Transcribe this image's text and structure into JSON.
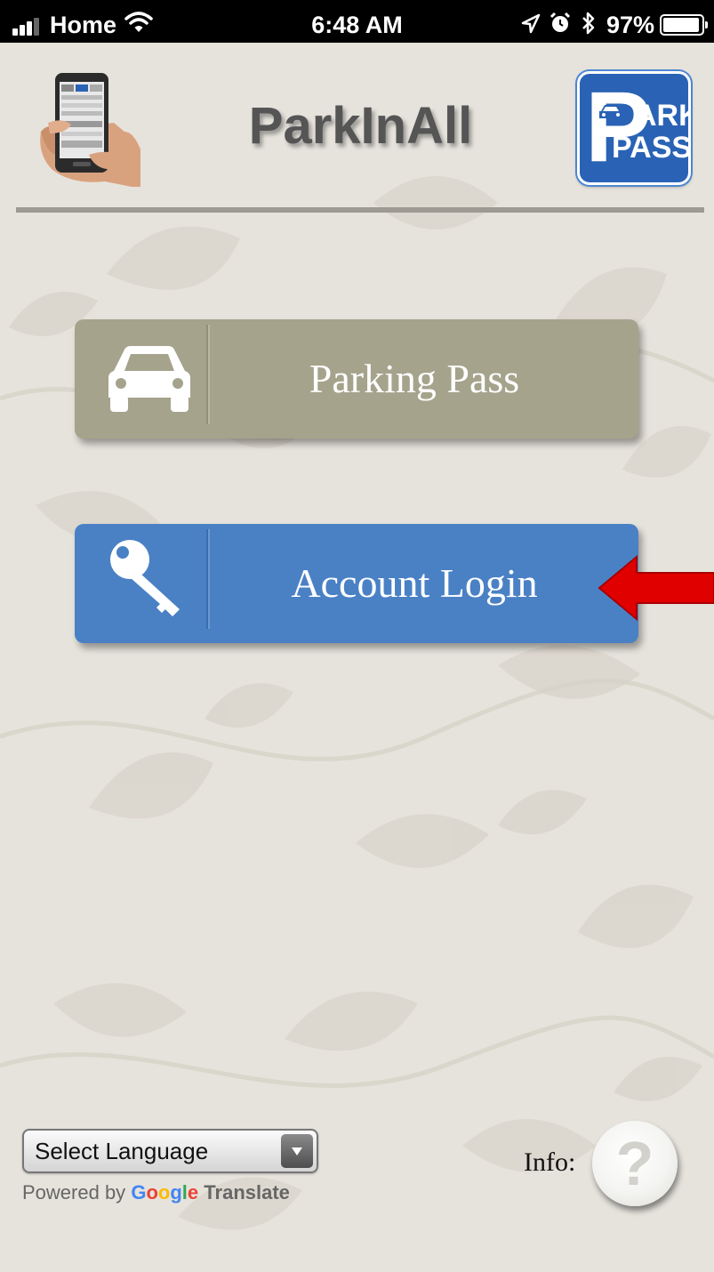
{
  "status_bar": {
    "carrier": "Home",
    "time": "6:48 AM",
    "battery": "97%",
    "battery_level": 0.97,
    "icons": [
      "signal-icon",
      "wifi-icon",
      "location-icon",
      "alarm-icon",
      "bluetooth-icon",
      "battery-icon"
    ]
  },
  "header": {
    "title": "ParkInAll",
    "logo_right": {
      "line1": "ARK",
      "line2": "PASS",
      "initial": "P"
    }
  },
  "buttons": {
    "parking_pass": {
      "label": "Parking Pass",
      "icon": "car-icon",
      "color": "#a5a38c"
    },
    "account_login": {
      "label": "Account Login",
      "icon": "key-icon",
      "color": "#4a81c5"
    }
  },
  "annotation": {
    "icon": "red-arrow-icon",
    "color": "#e00000"
  },
  "footer": {
    "language_select": {
      "selected": "Select Language"
    },
    "powered_by": "Powered by",
    "google": [
      "G",
      "o",
      "o",
      "g",
      "l",
      "e"
    ],
    "translate": "Translate",
    "info_label": "Info:",
    "info_icon": "?"
  },
  "colors": {
    "background": "#e6e3dc",
    "title": "#555555",
    "park_logo": "#2a63b5"
  }
}
